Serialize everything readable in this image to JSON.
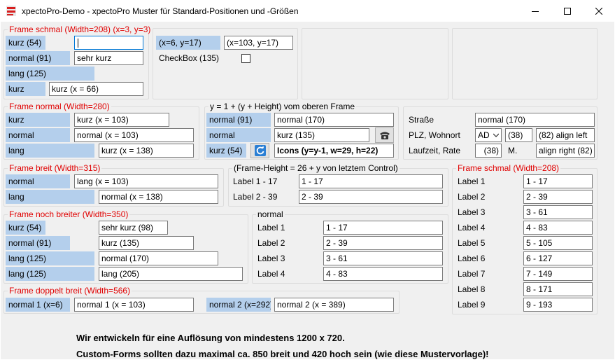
{
  "window": {
    "title": "xpectoPro-Demo - xpectoPro Muster für Standard-Positionen und -Größen",
    "minimize_icon": "minimize-icon",
    "maximize_icon": "maximize-icon",
    "close_icon": "close-icon"
  },
  "f1": {
    "caption": "Frame schmal (Width=208) (x=3, y=3)",
    "l1": "kurz (54)",
    "t1": "",
    "l2": "normal (91)",
    "t2": "sehr kurz",
    "l3": "lang (125)",
    "l4": "kurz",
    "t4": "kurz (x = 66)"
  },
  "f2": {
    "l1": "(x=6, y=17)",
    "t1": "(x=103, y=17)",
    "l2": "CheckBox (135)"
  },
  "f3": {
    "caption": "Frame normal (Width=280)",
    "l1": "kurz",
    "t1": "kurz (x = 103)",
    "l2": "normal",
    "t2": "normal (x = 103)",
    "l3": "lang",
    "t3": "kurz (x = 138)"
  },
  "f4": {
    "caption": "y = 1 + (y + Height) vom oberen Frame",
    "l1": "normal (91)",
    "t1": "normal (170)",
    "l2": "normal",
    "t2": "kurz (135)",
    "l3": "kurz (54)",
    "t3": "Icons (y=y-1, w=29, h=22)",
    "phone_icon": "phone-icon",
    "refresh_icon": "refresh-icon"
  },
  "f5": {
    "l1": "Straße",
    "t1": "normal (170)",
    "l2": "PLZ, Wohnort",
    "combo": "AD",
    "t2a": "(38)",
    "t2b": "(82) align left",
    "l3": "Laufzeit, Rate",
    "t3a": "(38)",
    "l3b": "M.",
    "t3b": "align right (82)"
  },
  "f6": {
    "caption": "Frame breit (Width=315)",
    "l1": "normal",
    "t1": "lang (x = 103)",
    "l2": "lang",
    "t2": "normal (x = 138)"
  },
  "f7": {
    "caption": "(Frame-Height = 26 + y von letztem Control)",
    "l1": "Label 1 -   17",
    "t1": "1 -   17",
    "l2": "Label 2 -   39",
    "t2": "2 -   39"
  },
  "f8": {
    "caption": "Frame schmal (Width=208)",
    "rows": [
      {
        "label": "Label 1",
        "value": "1 -   17"
      },
      {
        "label": "Label 2",
        "value": "2 -   39"
      },
      {
        "label": "Label 3",
        "value": "3 -   61"
      },
      {
        "label": "Label 4",
        "value": "4 -   83"
      },
      {
        "label": "Label 5",
        "value": "5 - 105"
      },
      {
        "label": "Label 6",
        "value": "6 - 127"
      },
      {
        "label": "Label 7",
        "value": "7 - 149"
      },
      {
        "label": "Label 8",
        "value": "8 - 171"
      },
      {
        "label": "Label 9",
        "value": "9 - 193"
      }
    ]
  },
  "f9": {
    "caption": "Frame noch breiter (Width=350)",
    "l1": "kurz (54)",
    "t1": "sehr kurz (98)",
    "l2": "normal (91)",
    "t2": "kurz (135)",
    "l3": "lang (125)",
    "t3": "normal (170)",
    "l4": "lang (125)",
    "t4": "lang (205)"
  },
  "f10": {
    "caption": "normal",
    "rows": [
      {
        "label": "Label 1",
        "value": "1 -   17"
      },
      {
        "label": "Label 2",
        "value": "2 -   39"
      },
      {
        "label": "Label 3",
        "value": "3 -   61"
      },
      {
        "label": "Label 4",
        "value": "4 -   83"
      }
    ]
  },
  "f11": {
    "caption": "Frame doppelt breit (Width=566)",
    "l1": "normal 1 (x=6)",
    "t1": "normal 1 (x = 103)",
    "l2": "normal 2 (x=292)",
    "t2": "normal 2 (x = 389)"
  },
  "notes": {
    "line1": "Wir entwickeln für eine Auflösung von mindestens 1200 x 720.",
    "line2": "Custom-Forms sollten dazu maximal ca. 850 breit und 420 hoch sein (wie diese Mustervorlage)!"
  }
}
